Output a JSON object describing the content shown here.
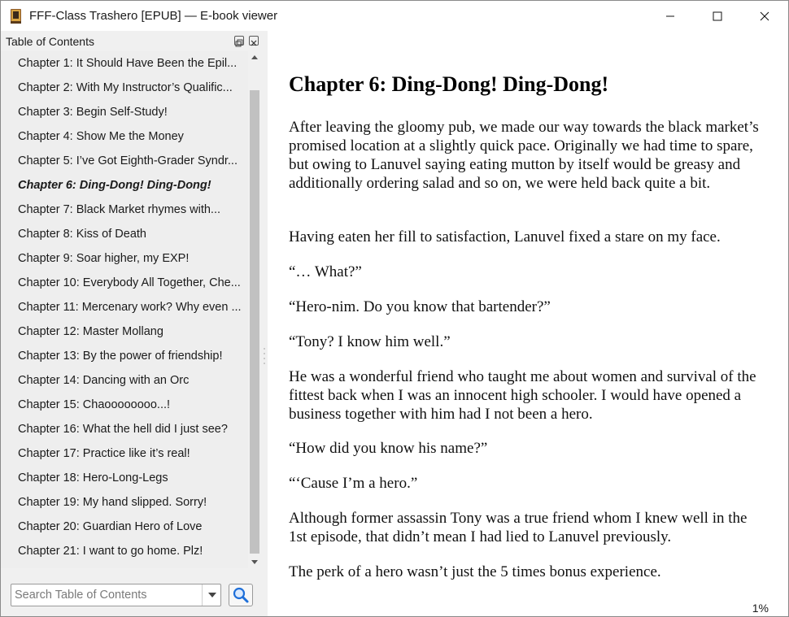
{
  "window": {
    "title": "FFF-Class Trashero [EPUB] — E-book viewer"
  },
  "toc": {
    "header": "Table of Contents",
    "items": [
      {
        "label": "Chapter 1: It Should Have Been the Epil..."
      },
      {
        "label": "Chapter 2: With My Instructor’s Qualific..."
      },
      {
        "label": "Chapter 3: Begin Self-Study!"
      },
      {
        "label": "Chapter 4: Show Me the Money"
      },
      {
        "label": "Chapter 5: I’ve Got Eighth-Grader Syndr..."
      },
      {
        "label": "Chapter 6: Ding-Dong! Ding-Dong!"
      },
      {
        "label": "Chapter 7: Black Market rhymes with..."
      },
      {
        "label": "Chapter 8: Kiss of Death"
      },
      {
        "label": "Chapter 9: Soar higher, my EXP!"
      },
      {
        "label": "Chapter 10: Everybody All Together, Che..."
      },
      {
        "label": "Chapter 11: Mercenary work? Why even ..."
      },
      {
        "label": "Chapter 12: Master Mollang"
      },
      {
        "label": "Chapter 13: By the power of friendship!"
      },
      {
        "label": "Chapter 14: Dancing with an Orc"
      },
      {
        "label": "Chapter 15: Chaoooooooo...!"
      },
      {
        "label": "Chapter 16: What the hell did I just see?"
      },
      {
        "label": "Chapter 17: Practice like it’s real!"
      },
      {
        "label": "Chapter 18: Hero-Long-Legs"
      },
      {
        "label": "Chapter 19: My hand slipped. Sorry!"
      },
      {
        "label": "Chapter 20: Guardian Hero of Love"
      },
      {
        "label": "Chapter 21: I want to go home. Plz!"
      }
    ],
    "current_index": 5,
    "search_placeholder": "Search Table of Contents"
  },
  "reader": {
    "chapter_title": "Chapter 6: Ding-Dong! Ding-Dong!",
    "paragraphs": [
      "After leaving the gloomy pub, we made our way towards the black market’s promised location at a slightly quick pace. Originally we had time to spare, but owing to Lanuvel saying eating mutton by itself would be greasy and additionally ordering salad and so on, we were held back quite a bit.",
      "Having eaten her fill to satisfaction, Lanuvel fixed a stare on my face.",
      "“… What?”",
      "“Hero-nim. Do you know that bartender?”",
      "“Tony? I know him well.”",
      "He was a wonderful friend who taught me about women and survival of the fittest back when I was an innocent high schooler. I would have opened a business together with him had I not been a hero.",
      "“How did you know his name?”",
      "“‘Cause I’m a hero.”",
      "Although former assassin Tony was a true friend whom I knew well in the 1st episode, that didn’t mean I had lied to Lanuvel previously.",
      "The perk of a hero wasn’t just the 5 times bonus experience."
    ],
    "progress": "1%"
  },
  "colors": {
    "panel_bg": "#f0f0f0",
    "scroll_thumb": "#c1c1c1",
    "search_icon_blue": "#1e6fd9"
  }
}
